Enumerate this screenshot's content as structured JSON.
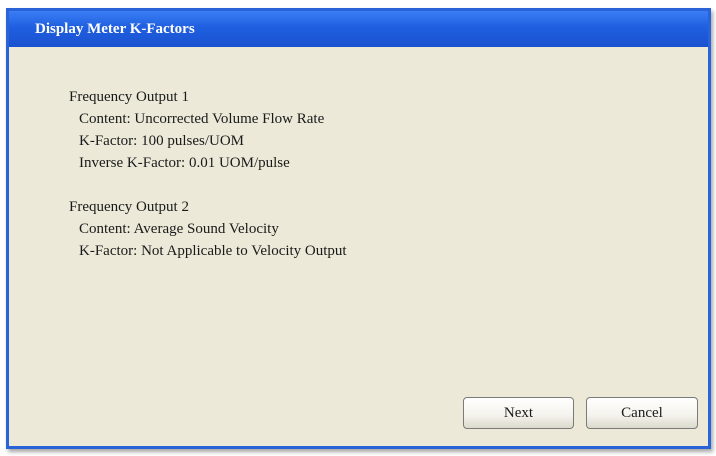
{
  "dialog": {
    "title": "Display Meter K-Factors"
  },
  "outputs": [
    {
      "heading": "Frequency Output 1",
      "lines": [
        "Content: Uncorrected Volume Flow Rate",
        "K-Factor: 100 pulses/UOM",
        "Inverse K-Factor: 0.01 UOM/pulse"
      ]
    },
    {
      "heading": "Frequency Output 2",
      "lines": [
        "Content: Average Sound Velocity",
        "K-Factor: Not Applicable to Velocity Output"
      ]
    }
  ],
  "buttons": {
    "next_label": "Next",
    "cancel_label": "Cancel"
  },
  "colors": {
    "titlebar": "#1f5fe0",
    "dialog_background": "#ece9d8"
  }
}
